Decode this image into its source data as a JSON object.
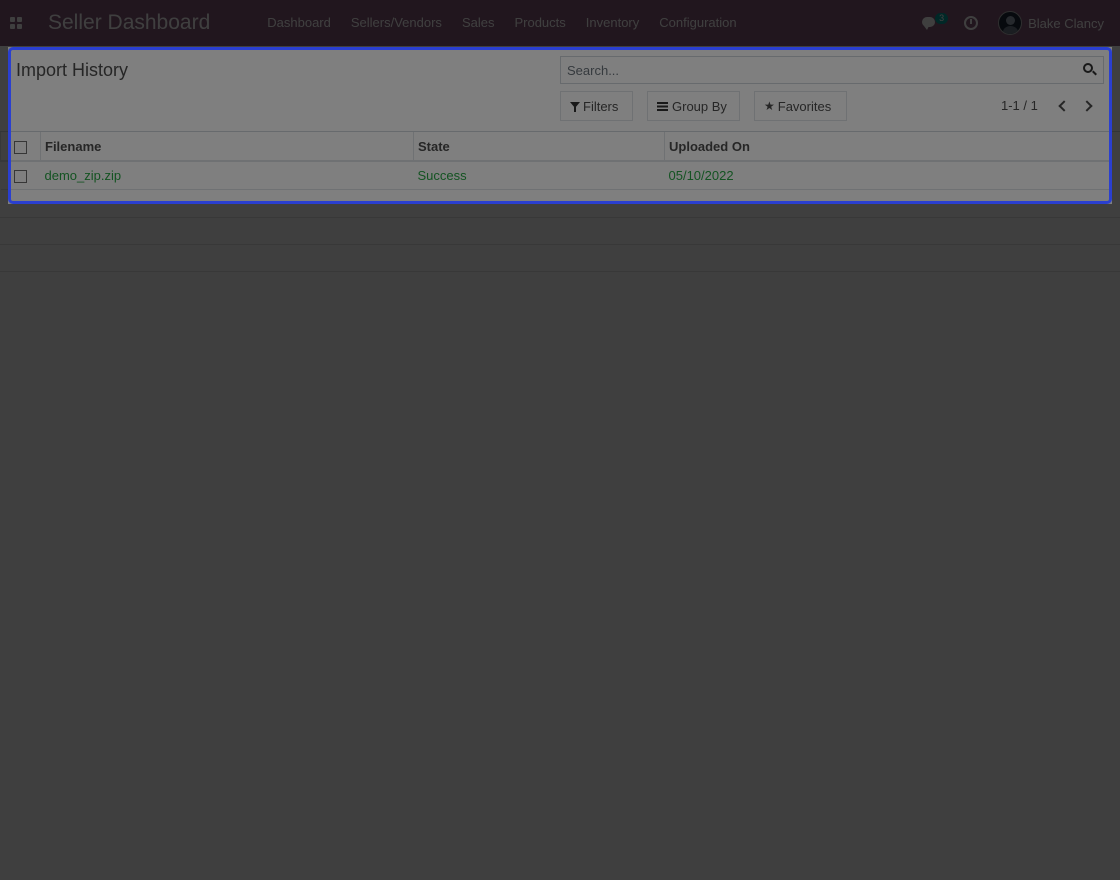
{
  "navbar": {
    "brand": "Seller Dashboard",
    "menu": [
      "Dashboard",
      "Sellers/Vendors",
      "Sales",
      "Products",
      "Inventory",
      "Configuration"
    ],
    "chat_count": "3",
    "user_name": "Blake Clancy",
    "icons": {
      "apps": "apps-grid-icon",
      "chat": "chat-icon",
      "activity": "clock-icon"
    }
  },
  "control_panel": {
    "title": "Import History",
    "search_placeholder": "Search...",
    "filters_label": "Filters",
    "group_by_label": "Group By",
    "favorites_label": "Favorites",
    "pager": "1-1 / 1"
  },
  "list": {
    "columns": [
      "Filename",
      "State",
      "Uploaded On"
    ],
    "rows": [
      {
        "filename": "demo_zip.zip",
        "state": "Success",
        "uploaded_on": "05/10/2022"
      }
    ]
  },
  "colors": {
    "navbar": "#875a7b",
    "row_text": "#28a745",
    "focus_border": "#2a3fd0",
    "badge": "#00a09d"
  }
}
